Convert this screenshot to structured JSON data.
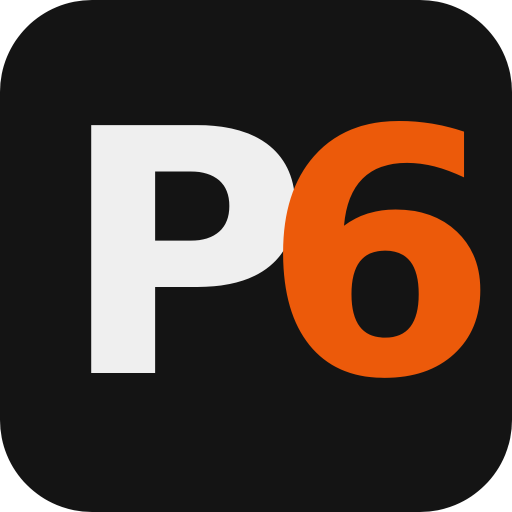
{
  "logo": {
    "letter": "P",
    "digit": "6",
    "colors": {
      "background": "#141414",
      "letter": "#efefef",
      "digit": "#ec5a0a"
    }
  }
}
